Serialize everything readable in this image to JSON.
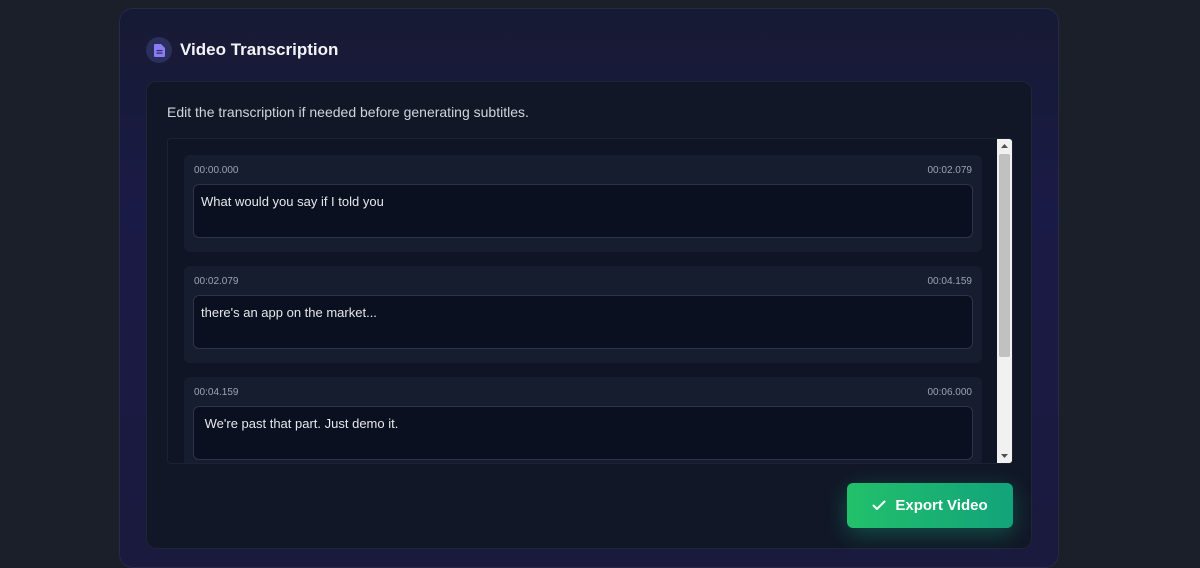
{
  "card": {
    "title": "Video Transcription",
    "icon": "document-icon"
  },
  "panel": {
    "instructions": "Edit the transcription if needed before generating subtitles."
  },
  "segments": [
    {
      "start": "00:00.000",
      "end": "00:02.079",
      "text": "What would you say if I told you"
    },
    {
      "start": "00:02.079",
      "end": "00:04.159",
      "text": "there's an app on the market..."
    },
    {
      "start": "00:04.159",
      "end": "00:06.000",
      "text": " We're past that part. Just demo it."
    }
  ],
  "actions": {
    "export_label": "Export Video",
    "export_icon": "check-icon"
  },
  "colors": {
    "accent": "#22c06b",
    "icon_accent": "#8b7cf6"
  }
}
